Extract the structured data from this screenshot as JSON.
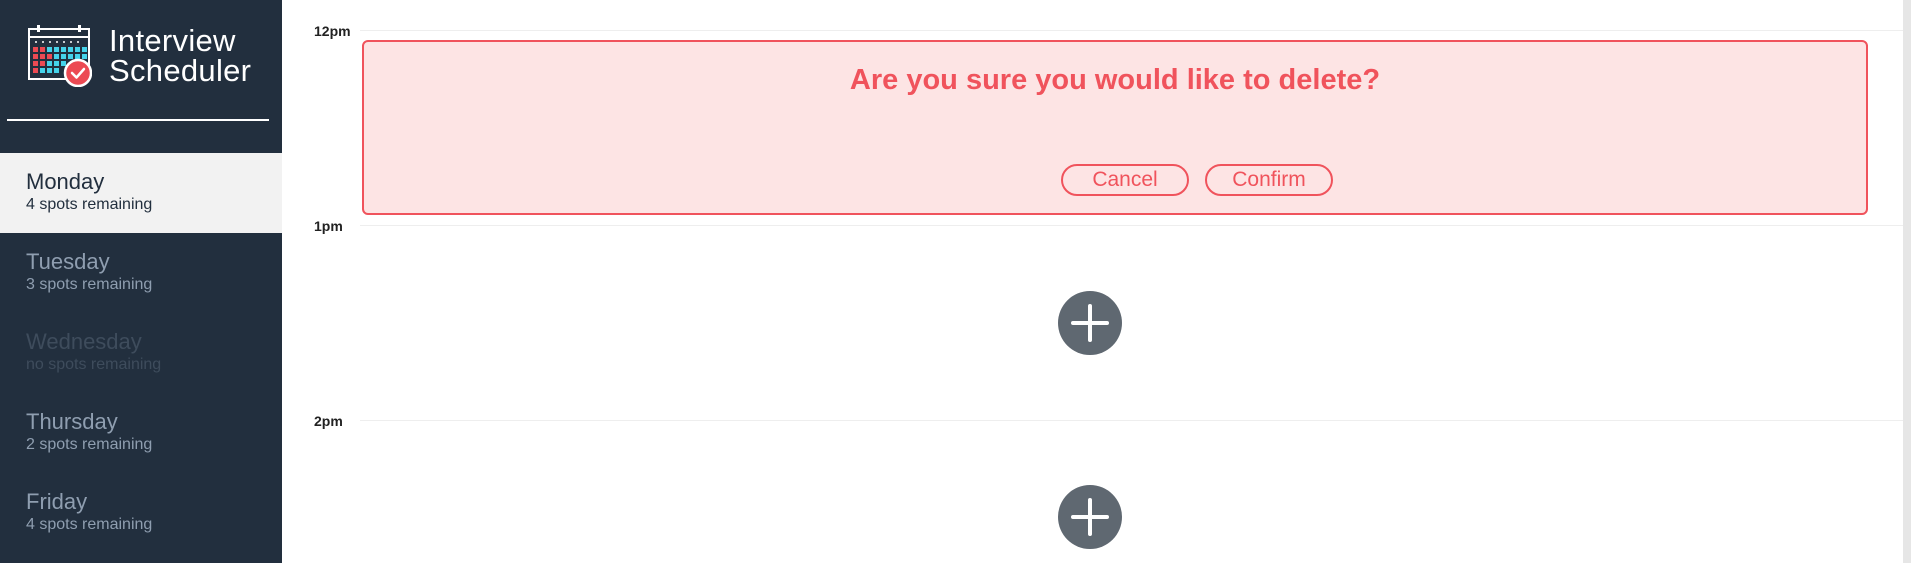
{
  "app": {
    "title_line1": "Interview",
    "title_line2": "Scheduler"
  },
  "sidebar": {
    "days": [
      {
        "name": "Monday",
        "spots": "4 spots remaining",
        "state": "selected"
      },
      {
        "name": "Tuesday",
        "spots": "3 spots remaining",
        "state": "available"
      },
      {
        "name": "Wednesday",
        "spots": "no spots remaining",
        "state": "full"
      },
      {
        "name": "Thursday",
        "spots": "2 spots remaining",
        "state": "available"
      },
      {
        "name": "Friday",
        "spots": "4 spots remaining",
        "state": "available"
      }
    ]
  },
  "schedule": {
    "times": [
      "12pm",
      "1pm",
      "2pm"
    ],
    "confirm": {
      "message": "Are you sure you would like to delete?",
      "cancel_label": "Cancel",
      "confirm_label": "Confirm"
    }
  },
  "icons": {
    "logo": "calendar-check-icon",
    "add": "plus-icon"
  },
  "colors": {
    "sidebar_bg": "#222f3e",
    "selected_bg": "#f2f2f2",
    "danger": "#f0535c",
    "danger_bg": "#fde4e4",
    "add_button": "#5f6871"
  }
}
